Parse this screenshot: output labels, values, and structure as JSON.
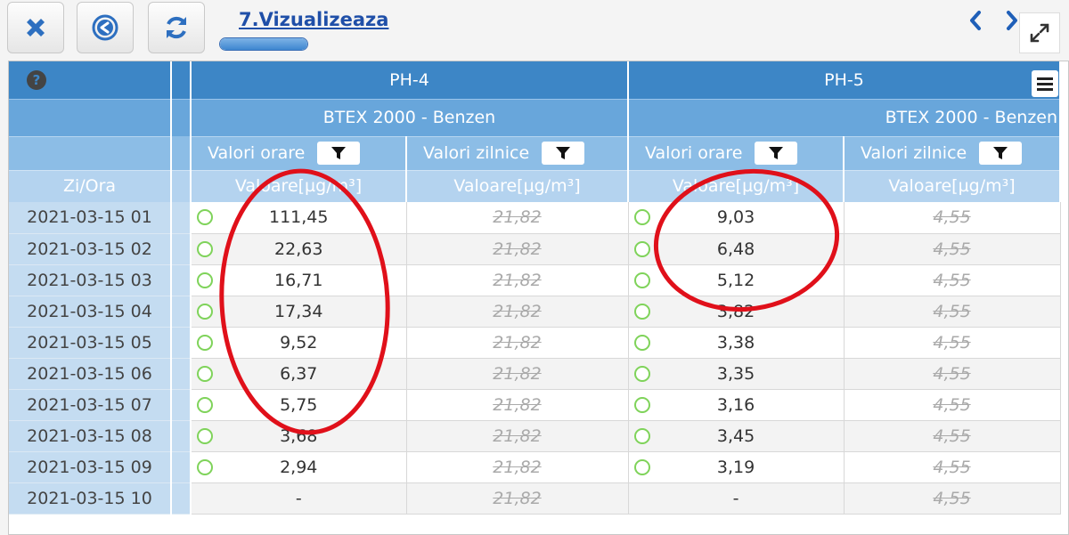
{
  "toolbar": {
    "title": "7.Vizualizeaza",
    "progress_fraction": 1.0
  },
  "grid": {
    "corner_header": "Zi/Ora",
    "stations": [
      {
        "name": "PH-4",
        "pollutant": "BTEX 2000 - Benzen",
        "col_hourly": "Valori orare",
        "col_daily": "Valori zilnice",
        "unit_hourly": "Valoare[µg/m³]",
        "unit_daily": "Valoare[µg/m³]"
      },
      {
        "name": "PH-5",
        "pollutant": "BTEX 2000 - Benzen",
        "col_hourly": "Valori orare",
        "col_daily": "Valori zilnice",
        "unit_hourly": "Valoare[µg/m³]",
        "unit_daily": "Valoare[µg/m³]"
      }
    ],
    "rows": [
      {
        "date": "2021-03-15 01",
        "ph4_hourly": "111,45",
        "ph4_daily": "21,82",
        "ph5_hourly": "9,03",
        "ph5_daily": "4,55"
      },
      {
        "date": "2021-03-15 02",
        "ph4_hourly": "22,63",
        "ph4_daily": "21,82",
        "ph5_hourly": "6,48",
        "ph5_daily": "4,55"
      },
      {
        "date": "2021-03-15 03",
        "ph4_hourly": "16,71",
        "ph4_daily": "21,82",
        "ph5_hourly": "5,12",
        "ph5_daily": "4,55"
      },
      {
        "date": "2021-03-15 04",
        "ph4_hourly": "17,34",
        "ph4_daily": "21,82",
        "ph5_hourly": "3,82",
        "ph5_daily": "4,55"
      },
      {
        "date": "2021-03-15 05",
        "ph4_hourly": "9,52",
        "ph4_daily": "21,82",
        "ph5_hourly": "3,38",
        "ph5_daily": "4,55"
      },
      {
        "date": "2021-03-15 06",
        "ph4_hourly": "6,37",
        "ph4_daily": "21,82",
        "ph5_hourly": "3,35",
        "ph5_daily": "4,55"
      },
      {
        "date": "2021-03-15 07",
        "ph4_hourly": "5,75",
        "ph4_daily": "21,82",
        "ph5_hourly": "3,16",
        "ph5_daily": "4,55"
      },
      {
        "date": "2021-03-15 08",
        "ph4_hourly": "3,68",
        "ph4_daily": "21,82",
        "ph5_hourly": "3,45",
        "ph5_daily": "4,55"
      },
      {
        "date": "2021-03-15 09",
        "ph4_hourly": "2,94",
        "ph4_daily": "21,82",
        "ph5_hourly": "3,19",
        "ph5_daily": "4,55"
      },
      {
        "date": "2021-03-15 10",
        "ph4_hourly": "-",
        "ph4_daily": "21,82",
        "ph5_hourly": "-",
        "ph5_daily": "4,55"
      }
    ]
  },
  "icons": {
    "close": "close-icon",
    "back": "back-circle-icon",
    "refresh": "refresh-icon",
    "prev": "chevron-left-icon",
    "next": "chevron-right-icon",
    "expand": "expand-icon",
    "help": "help-icon",
    "menu": "hamburger-menu-icon",
    "filter": "filter-icon",
    "status": "status-circle-icon"
  },
  "colors": {
    "header_dark": "#3d86c6",
    "header_mid": "#68a6db",
    "header_light": "#8cbde6",
    "date_column": "#c4dcf1",
    "status_ok": "#7fd35a",
    "annotation": "#e0101a"
  }
}
